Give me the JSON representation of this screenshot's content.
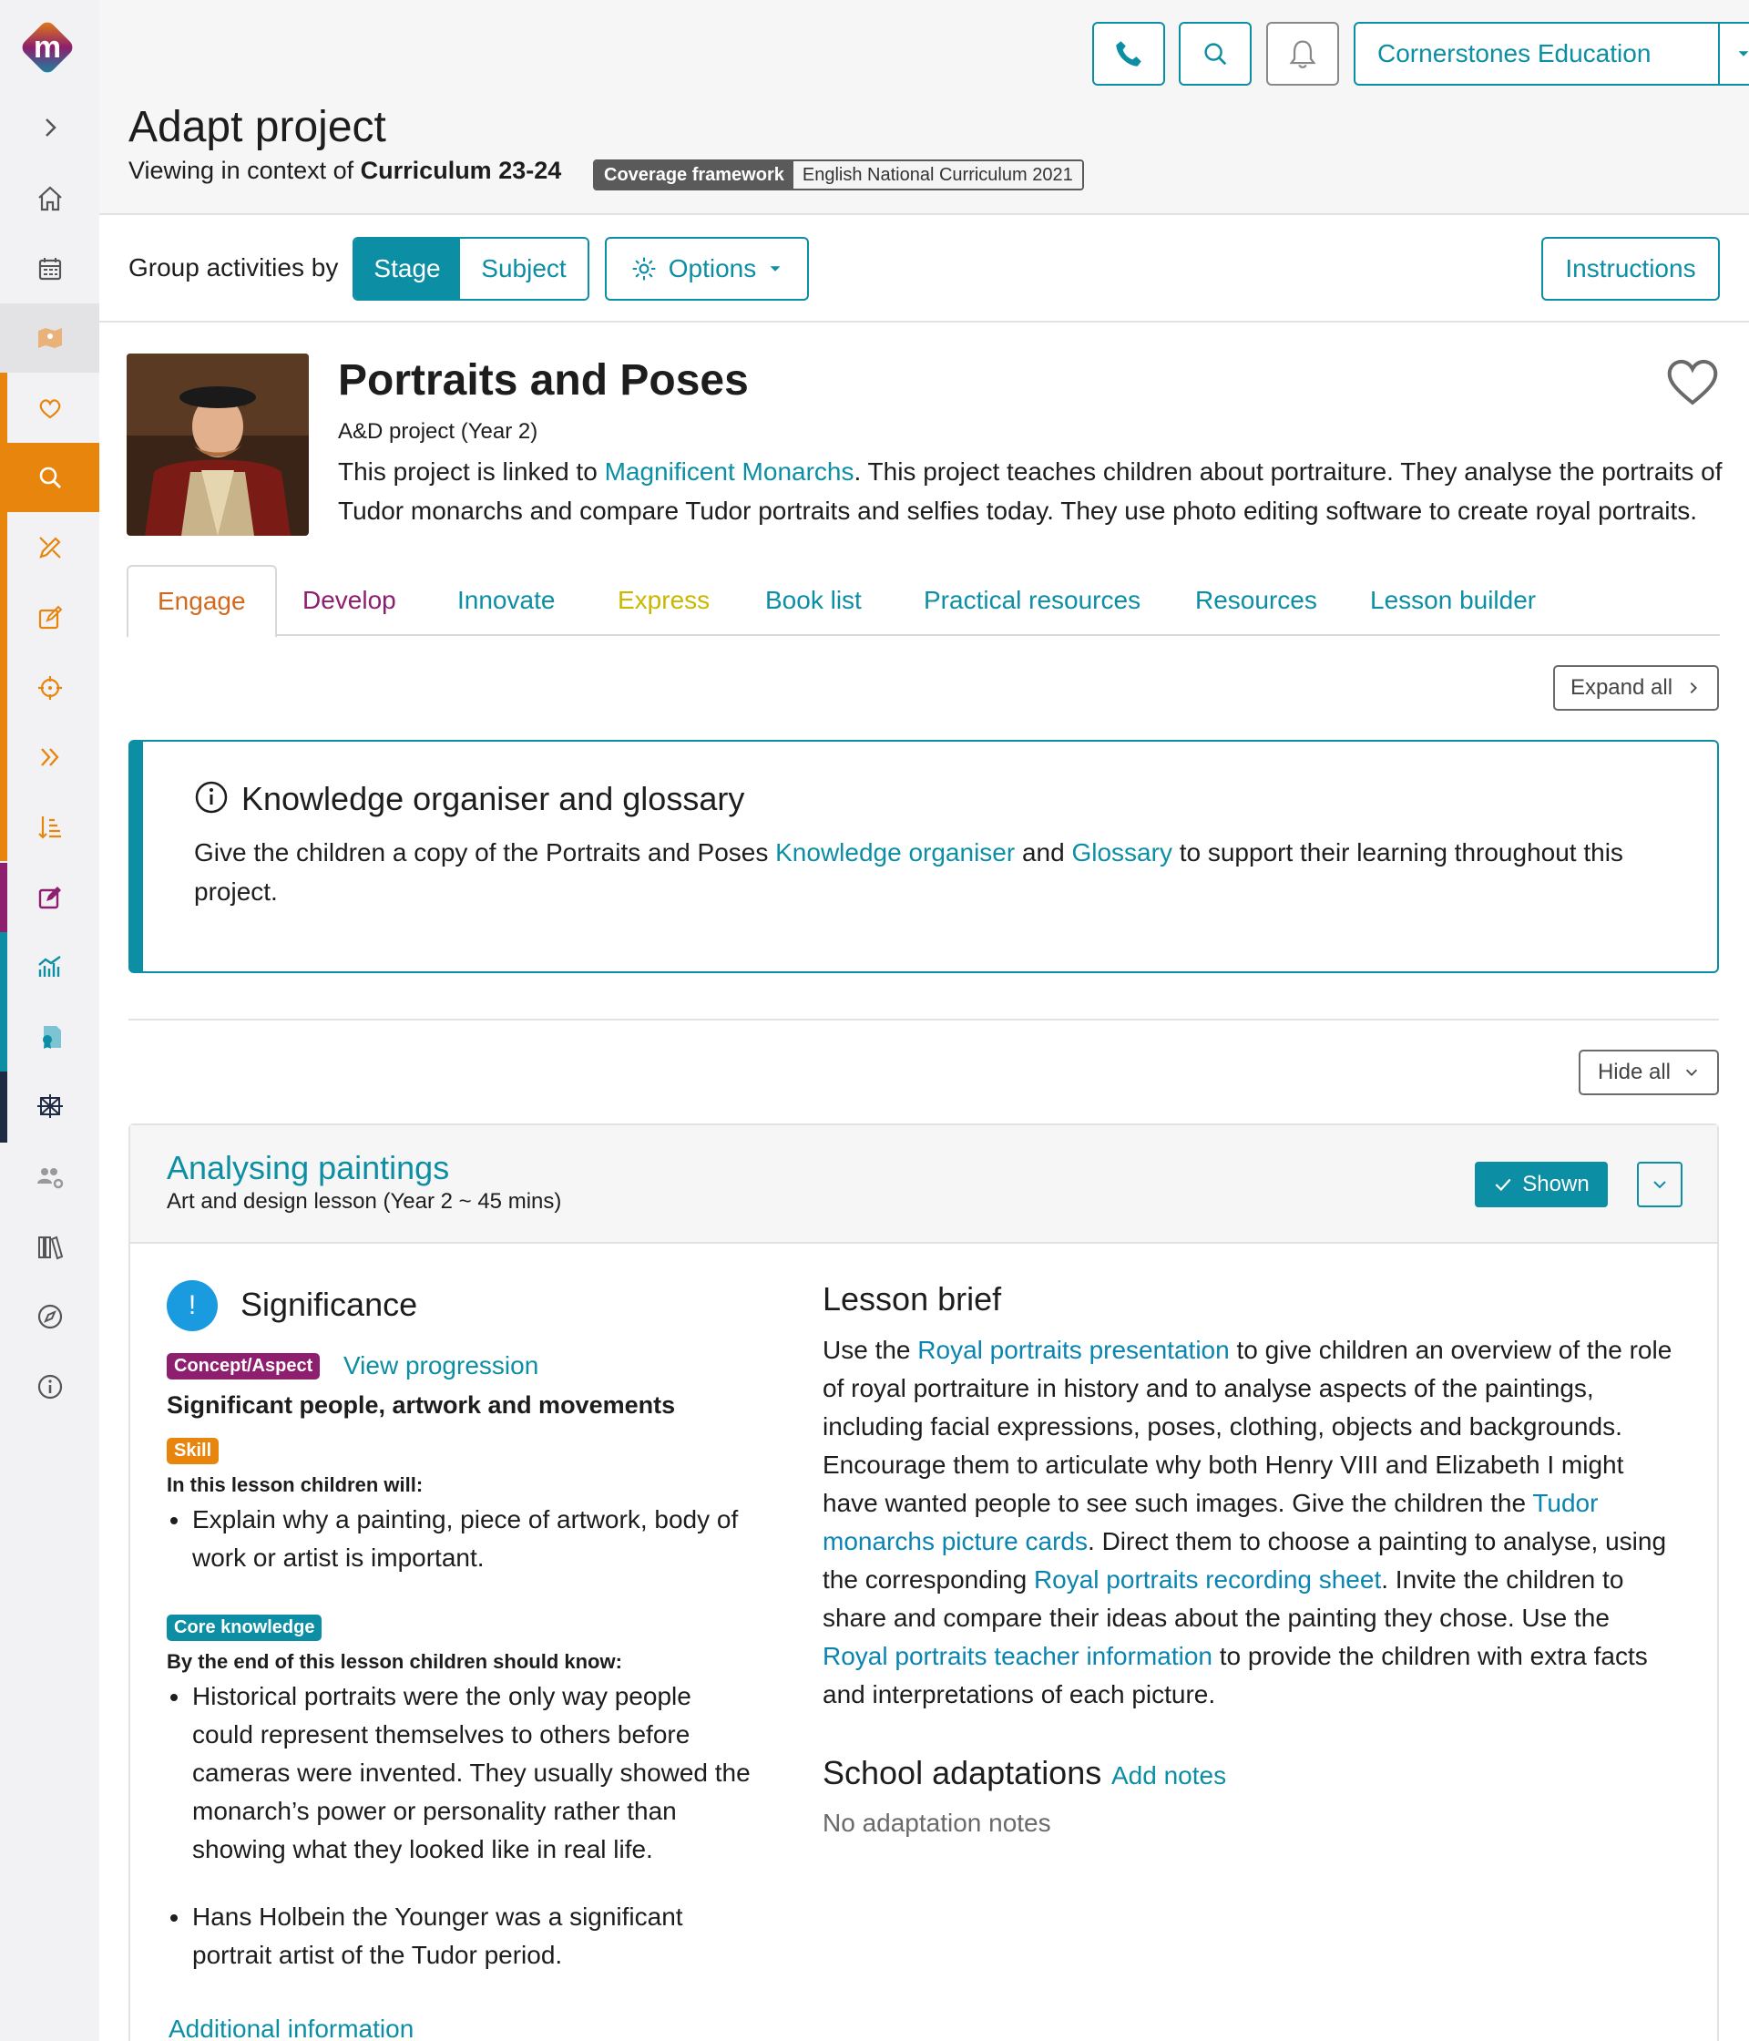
{
  "header": {
    "account_label": "Cornerstones Education",
    "page_title": "Adapt project",
    "context_prefix": "Viewing in context of",
    "context_value": "Curriculum 23-24",
    "coverage_label": "Coverage framework",
    "coverage_value": "English National Curriculum 2021"
  },
  "toolbar": {
    "group_label": "Group activities by",
    "stage_label": "Stage",
    "subject_label": "Subject",
    "options_label": "Options",
    "instructions_label": "Instructions"
  },
  "project": {
    "title": "Portraits and Poses",
    "subtitle": "A&D project (Year 2)",
    "desc_before": "This project is linked to ",
    "desc_link": "Magnificent Monarchs",
    "desc_after": ". This project teaches children about portraiture. They analyse the portraits of Tudor monarchs and compare Tudor portraits and selfies today. They use photo editing software to create royal portraits."
  },
  "tabs": [
    {
      "label": "Engage",
      "color": "#d2691e"
    },
    {
      "label": "Develop",
      "color": "#8e1e6e"
    },
    {
      "label": "Innovate",
      "color": "#0c8ea4"
    },
    {
      "label": "Express",
      "color": "#c9b800"
    },
    {
      "label": "Book list",
      "color": "#0c8ea4"
    },
    {
      "label": "Practical resources",
      "color": "#0c8ea4"
    },
    {
      "label": "Resources",
      "color": "#0c8ea4"
    },
    {
      "label": "Lesson builder",
      "color": "#0c8ea4"
    }
  ],
  "controls": {
    "expand_all": "Expand all",
    "hide_all": "Hide all"
  },
  "knowledge": {
    "title": "Knowledge organiser and glossary",
    "text_before": "Give the children a copy of the Portraits and Poses ",
    "link1": "Knowledge organiser",
    "text_mid": " and ",
    "link2": "Glossary",
    "text_after": " to support their learning throughout this project."
  },
  "lesson": {
    "title": "Analysing paintings",
    "subtitle": "Art and design lesson (Year 2 ~ 45 mins)",
    "shown_label": "Shown",
    "significance_icon": "!",
    "significance_title": "Significance",
    "concept_pill": "Concept/Aspect",
    "view_progression": "View progression",
    "concept_title": "Significant people, artwork and movements",
    "skill_pill": "Skill",
    "skill_intro": "In this lesson children will:",
    "skill_items": [
      "Explain why a painting, piece of artwork, body of work or artist is important."
    ],
    "core_pill": "Core knowledge",
    "core_intro": "By the end of this lesson children should know:",
    "core_items": [
      "Historical portraits were the only way people could represent themselves to others before cameras were invented. They usually showed the monarch’s power or personality rather than showing what they looked like in real life.",
      "Hans Holbein the Younger was a significant portrait artist of the Tudor period."
    ],
    "additional_info": "Additional information",
    "brief_title": "Lesson brief",
    "brief_parts": {
      "p1": "Use the ",
      "l1": "Royal portraits presentation",
      "p2": " to give children an overview of the role of royal portraiture in history and to analyse aspects of the paintings, including facial expressions, poses, clothing, objects and backgrounds. Encourage them to articulate why both Henry VIII and Elizabeth I might have wanted people to see such images. Give the children the ",
      "l2": "Tudor monarchs picture cards",
      "p3": ". Direct them to choose a painting to analyse, using the corresponding ",
      "l3": "Royal portraits recording sheet",
      "p4": ". Invite the children to share and compare their ideas about the painting they chose. Use the ",
      "l4": "Royal portraits teacher information",
      "p5": " to provide the children with extra facts and interpretations of each picture."
    },
    "adapt_title": "School adaptations",
    "adapt_link": "Add notes",
    "adapt_none": "No adaptation notes"
  },
  "colors": {
    "brand": "#0c8ea4",
    "orange": "#e8850c",
    "purple": "#8e1e6e",
    "navy": "#1f2a44",
    "skill": "#e8850c",
    "concept": "#8e1e6e"
  },
  "logo_letter": "m",
  "sidebar_icons": [
    "expand-icon",
    "home-icon",
    "calendar-icon",
    "map-icon",
    "heart-icon",
    "search-icon",
    "pencil-ruler-icon",
    "edit-icon",
    "target-icon",
    "double-chevron-icon",
    "sort-icon",
    "note-edit-icon",
    "chart-icon",
    "certificate-icon",
    "network-icon",
    "users-gear-icon",
    "books-icon",
    "compass-icon",
    "info-icon"
  ]
}
